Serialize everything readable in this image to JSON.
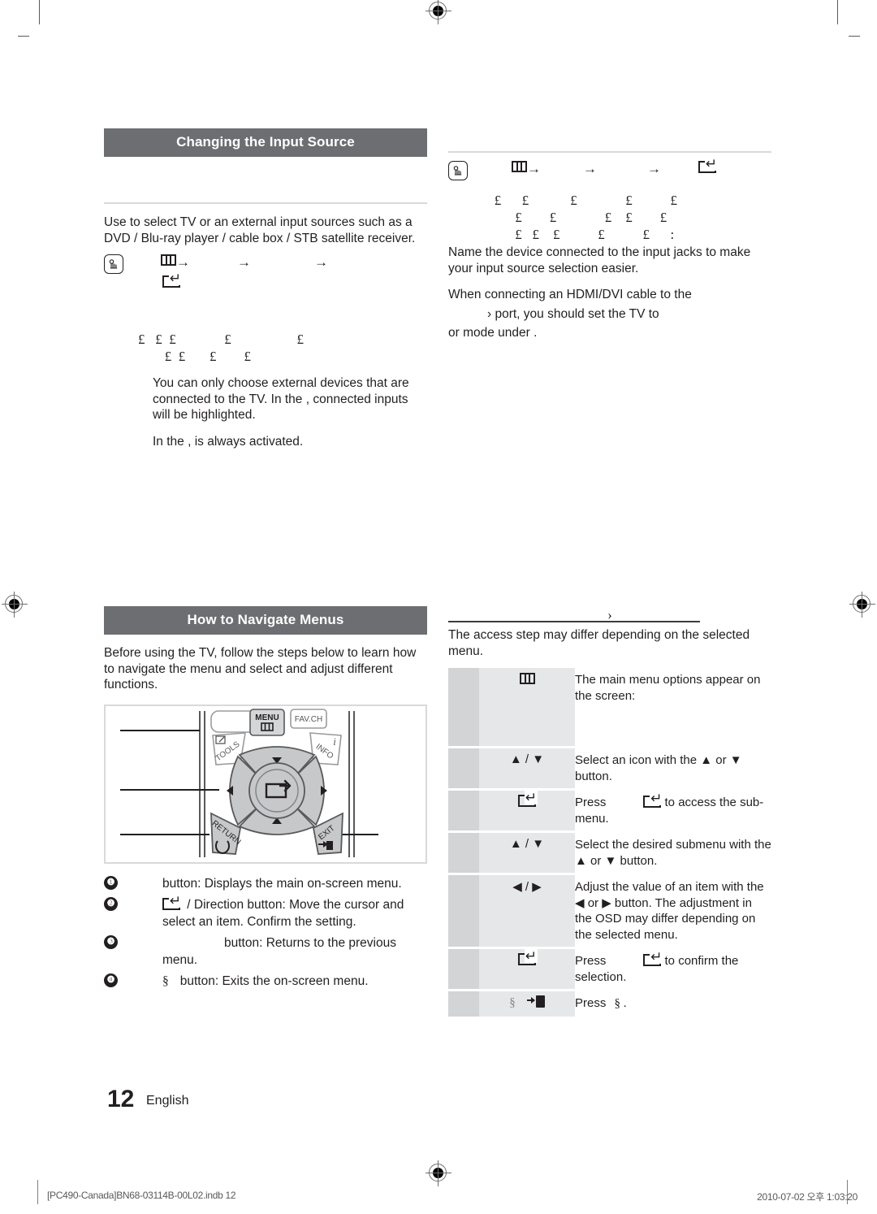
{
  "document": {
    "page_number": "12",
    "language": "English",
    "footer_left": "[PC490-Canada]BN68-03114B-00L02.indb   12",
    "footer_right": "2010-07-02   오후 1:03:20"
  },
  "left_column": {
    "section_title": "Changing the Input Source",
    "intro": "Use to select TV or an external input sources such as a DVD / Blu-ray player / cable box / STB satellite receiver.",
    "path_row": {
      "hand_icon": "hand-press-icon",
      "menu_icon": "menu-icon",
      "enter_icon": "enter-icon",
      "arrow": "→"
    },
    "glyph_rows": [
      "£   £  £              £                   £",
      "   £  £       £        £"
    ],
    "note_1": "You can only choose external devices that are connected to the TV. In the                         , connected inputs will be highlighted.",
    "note_2": "In the                     ,      is always activated."
  },
  "right_column": {
    "path_row": {
      "hand_icon": "hand-press-icon",
      "menu_icon": "menu-icon",
      "enter_icon": "enter-icon",
      "arrow": "→"
    },
    "glyph_rows": [
      "   £      £            £              £           £",
      "         £        £              £    £        £",
      "         £   £    £           £           £      :"
    ],
    "note_1": "Name the device connected to the input jacks to make your input source selection easier.",
    "note_2": "When connecting an HDMI/DVI cable to the",
    "note_3": "›           port, you should set the TV to",
    "note_4": "or                 mode under                        ."
  },
  "navigate_section": {
    "section_title": "How to Navigate Menus",
    "intro": "Before using the TV, follow the steps below to learn how to navigate the menu and select and adjust different functions.",
    "remote": {
      "menu_button_label": "MENU",
      "fav_button_label": "FAV.CH",
      "tools_button_label": "TOOLS",
      "info_button_label": "INFO",
      "info_icon": "i",
      "return_button_label": "RETURN",
      "exit_button_label": "EXIT",
      "up_icon": "▲",
      "down_icon": "▼",
      "left_icon": "◀",
      "right_icon": "▶",
      "enter_icon": "enter-icon"
    },
    "legend": [
      {
        "num": "❶",
        "gap": "            ",
        "text": "button: Displays the main on-screen menu."
      },
      {
        "num": "❷",
        "gap": "           ",
        "text": " / Direction button: Move the cursor and select an item. Confirm the setting."
      },
      {
        "num": "❸",
        "gap": "                 ",
        "text": "button: Returns to the previous menu."
      },
      {
        "num": "❹",
        "gap": "  ",
        "text": "button: Exits the on-screen menu.",
        "prefix": "§"
      }
    ]
  },
  "navigate_table": {
    "heading_glyph": "›",
    "caption": "The access step may differ depending on the selected menu.",
    "rows": [
      {
        "button": "menu-icon",
        "button_text": "",
        "desc": "The main menu options appear on the screen:",
        "tall": true
      },
      {
        "button": "updown-icon",
        "button_text": "▲ / ▼",
        "desc": "Select an icon with the ▲ or ▼ button."
      },
      {
        "button": "enter-icon",
        "button_text": "",
        "desc_pre": "Press",
        "desc_post": "to access the sub-menu."
      },
      {
        "button": "updown-icon",
        "button_text": "▲ / ▼",
        "desc": "Select the desired submenu with the ▲ or ▼ button."
      },
      {
        "button": "leftright-icon",
        "button_text": "◀ / ▶",
        "desc": "Adjust the value of an item with the ◀ or ▶ button. The adjustment in the OSD may differ depending on the selected menu.",
        "tall2": true
      },
      {
        "button": "enter-icon",
        "button_text": "",
        "desc_pre": "Press",
        "desc_post": "to confirm the selection."
      },
      {
        "button": "exit-icon",
        "button_text": "§",
        "desc_pre": "Press",
        "desc_post": "§ ."
      }
    ]
  }
}
